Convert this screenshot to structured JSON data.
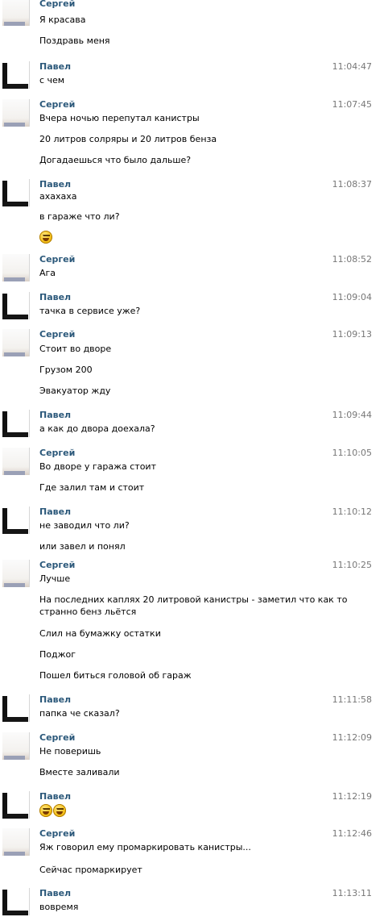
{
  "messages": [
    {
      "author": "Сергей",
      "time": "",
      "lines": [
        "Я красава",
        "Поздравь меня"
      ]
    },
    {
      "author": "Павел",
      "time": "11:04:47",
      "lines": [
        "с чем"
      ]
    },
    {
      "author": "Сергей",
      "time": "11:07:45",
      "lines": [
        "Вчера ночью перепутал канистры",
        "20 литров солряры и 20 литров бенза",
        "Догадаешься что было дальше?"
      ]
    },
    {
      "author": "Павел",
      "time": "11:08:37",
      "lines": [
        "ахахаха",
        "в гараже что ли?"
      ],
      "emoji": [
        {
          "icon": "laughing-face-icon",
          "count": 1
        }
      ]
    },
    {
      "author": "Сергей",
      "time": "11:08:52",
      "lines": [
        "Ага"
      ]
    },
    {
      "author": "Павел",
      "time": "11:09:04",
      "lines": [
        "тачка в сервисе уже?"
      ]
    },
    {
      "author": "Сергей",
      "time": "11:09:13",
      "lines": [
        "Стоит во дворе",
        "Грузом 200",
        "Эвакуатор жду"
      ]
    },
    {
      "author": "Павел",
      "time": "11:09:44",
      "lines": [
        "а как до двора доехала?"
      ]
    },
    {
      "author": "Сергей",
      "time": "11:10:05",
      "lines": [
        "Во дворе у гаража стоит",
        "Где залил там и стоит"
      ]
    },
    {
      "author": "Павел",
      "time": "11:10:12",
      "lines": [
        "не заводил что ли?",
        "или завел и понял"
      ]
    },
    {
      "author": "Сергей",
      "time": "11:10:25",
      "lines": [
        "Лучше",
        "На последних каплях 20 литровой канистры - заметил что как то",
        "странно бенз льётся",
        "Слил на бумажку остатки",
        "Поджог",
        "Пошел биться головой об гараж"
      ]
    },
    {
      "author": "Павел",
      "time": "11:11:58",
      "lines": [
        "папка че сказал?"
      ]
    },
    {
      "author": "Сергей",
      "time": "11:12:09",
      "lines": [
        "Не поверишь",
        "Вместе заливали"
      ]
    },
    {
      "author": "Павел",
      "time": "11:12:19",
      "lines": [],
      "emoji": [
        {
          "icon": "laughing-face-icon",
          "count": 2
        }
      ]
    },
    {
      "author": "Сергей",
      "time": "11:12:46",
      "lines": [
        "Яж говорил ему промаркировать канистры...",
        "Сейчас промаркирует"
      ]
    },
    {
      "author": "Павел",
      "time": "11:13:11",
      "lines": [
        "вовремя"
      ]
    }
  ]
}
